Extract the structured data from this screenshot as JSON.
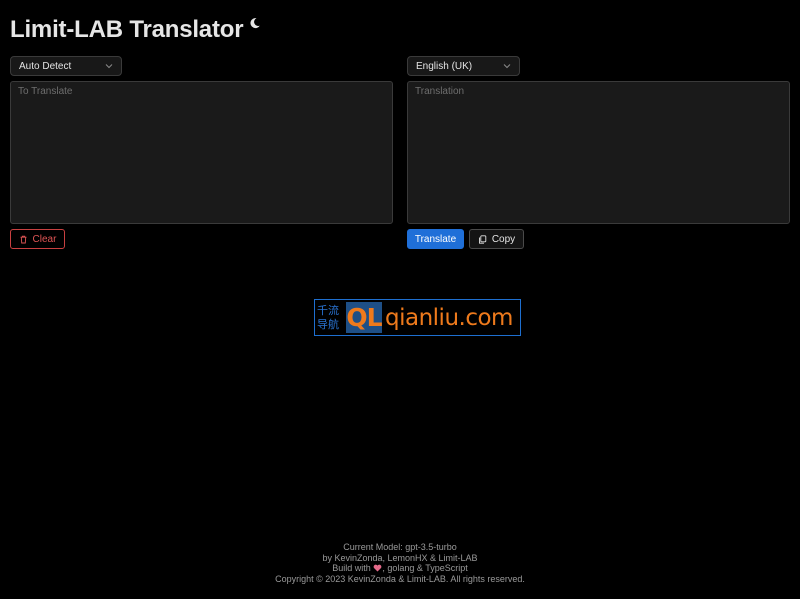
{
  "header": {
    "title": "Limit-LAB Translator",
    "theme_toggle_icon": "moon-icon"
  },
  "source": {
    "language": "Auto Detect",
    "placeholder": "To Translate",
    "value": "",
    "clear_label": "Clear",
    "clear_icon": "trash-icon"
  },
  "target": {
    "language": "English (UK)",
    "placeholder": "Translation",
    "value": "",
    "translate_label": "Translate",
    "copy_label": "Copy",
    "copy_icon": "copy-icon"
  },
  "watermark": {
    "cn_line1": "千流",
    "cn_line2": "导航",
    "mark": "QL",
    "domain": "qianliu.com"
  },
  "footer": {
    "model_line": "Current Model: gpt-3.5-turbo",
    "authors_line": "by KevinZonda, LemonHX & Limit-LAB",
    "build_prefix": "Build with",
    "build_suffix": ", golang & TypeScript",
    "copyright": "Copyright © 2023 KevinZonda & Limit-LAB. All rights reserved."
  },
  "colors": {
    "background": "#000000",
    "panel": "#1a1a1a",
    "border": "#3a3a3a",
    "primary": "#1f6fd8",
    "danger": "#e05555",
    "watermark_blue": "#1e6fd0",
    "watermark_orange": "#ee7a1c"
  }
}
